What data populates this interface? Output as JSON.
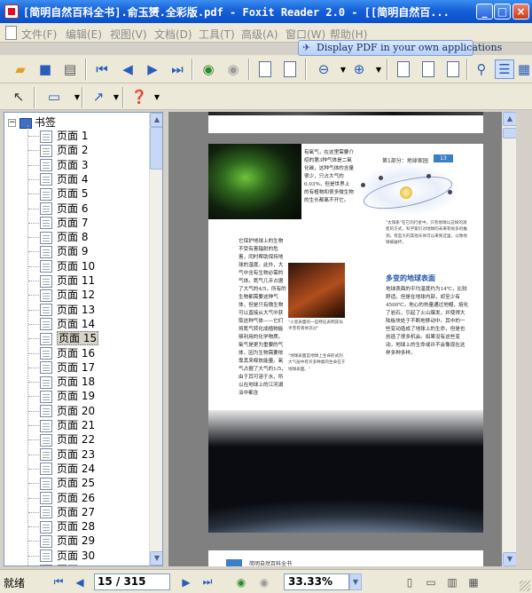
{
  "window": {
    "title": "[简明自然百科全书].俞玉赟.全彩版.pdf - Foxit Reader 2.0 - [[简明自然百..."
  },
  "menu": {
    "items": [
      {
        "label": "文件(F)"
      },
      {
        "label": "编辑(E)"
      },
      {
        "label": "视图(V)"
      },
      {
        "label": "文档(D)"
      },
      {
        "label": "工具(T)"
      },
      {
        "label": "高级(A)"
      },
      {
        "label": "窗口(W)"
      },
      {
        "label": "帮助(H)"
      }
    ],
    "ad_text": "Display PDF in your own applications"
  },
  "sidebar": {
    "root_label": "书签",
    "selected_index": 14,
    "items": [
      "页面 1",
      "页面 2",
      "页面 3",
      "页面 4",
      "页面 5",
      "页面 6",
      "页面 7",
      "页面 8",
      "页面 9",
      "页面 10",
      "页面 11",
      "页面 12",
      "页面 13",
      "页面 14",
      "页面 15",
      "页面 16",
      "页面 17",
      "页面 18",
      "页面 19",
      "页面 20",
      "页面 21",
      "页面 22",
      "页面 23",
      "页面 24",
      "页面 25",
      "页面 26",
      "页面 27",
      "页面 28",
      "页面 29",
      "页面 30",
      "页面 31"
    ]
  },
  "document": {
    "page_header": "第1部分：地球家园",
    "page_number": "13",
    "col_left_top": "有氧气，在这里需要介绍的第3种气体是二氧化碳，这种气体的含量很少，只占大气的0.03%，但是世界上的有植物和很多微生物的生长都离不开它。",
    "col_left_main": "它保护地球上的生物不受有害辐射的危害，同时帮助保持地球的温度。此外，大气中含有生物必需的气体。氮气几乎占据了大气的4/5，所有的生物都需要这种气体，但是只有微生物可以直接从大气中获取这种气体——它们将氮气转化成植物能够利用的化学物质。氧气是更为重要的气体，因为生物需要依靠其来释放能量。氧气占据了大气的1/5，由于其可溶于水，所以在地球上的江河湖泊中都含",
    "solar_caption": "\"太阳系\"在它的行星中，只有地球以这样的演变的方式，科学家们对地球的未来有很多的推测。有些大的其他天体可以来到这里，以致地球被破坏。",
    "mars_caption_1": "\"火星表面的一些特征表明其似乎曾有液体流过\"",
    "mars_caption_2": "\"地球表面是地球上生命形式的大气层中有许多种类的生命在于地球表面。\"",
    "subheading": "多变的地球表面",
    "col_right": "地球表面的平均温度约为14℃，比较舒适。但是在地球内部，却至少有4500℃，地心的热量通过地幔，熔化了岩石，引起了火山爆发，并使得大陆板块处于不断地移动中。其中的一些变动造成了地球上的生命，但是也创造了很多机会。如果没有这些变动，地球上的生命或许不会像现在这样多种多样。",
    "next_page_number": "14",
    "next_page_header": "简明自然百科全书"
  },
  "status": {
    "ready_text": "就绪",
    "page_display": "15 / 315",
    "zoom": "33.33%"
  },
  "colors": {
    "titlebar": "#0a4fc9",
    "chrome": "#ece9d8",
    "accent": "#3a7fc8",
    "doc_background": "#808080"
  },
  "icons": [
    "open-folder-icon",
    "save-icon",
    "print-icon",
    "first-page-icon",
    "prev-page-icon",
    "next-page-icon",
    "last-page-icon",
    "back-icon",
    "forward-icon",
    "extract-page-icon",
    "rotate-page-icon",
    "zoom-out-icon",
    "zoom-in-icon",
    "single-page-icon",
    "continuous-icon",
    "facing-icon",
    "find-icon",
    "bookmark-view-icon",
    "select-tool-icon",
    "annotation-tool-icon",
    "arrow-tool-icon",
    "help-icon"
  ]
}
